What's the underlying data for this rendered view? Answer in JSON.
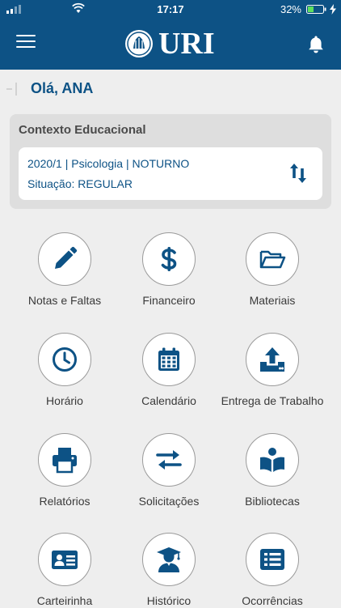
{
  "status_bar": {
    "time": "17:17",
    "battery": "32%"
  },
  "header": {
    "logo_text": "URI"
  },
  "greeting": "Olá, ANA",
  "context": {
    "title": "Contexto Educacional",
    "line1": "2020/1 | Psicologia | NOTURNO",
    "line2": "Situação: REGULAR"
  },
  "menu": [
    {
      "label": "Notas e Faltas",
      "icon": "pencil-icon"
    },
    {
      "label": "Financeiro",
      "icon": "dollar-icon"
    },
    {
      "label": "Materiais",
      "icon": "folder-open-icon"
    },
    {
      "label": "Horário",
      "icon": "clock-icon"
    },
    {
      "label": "Calendário",
      "icon": "calendar-icon"
    },
    {
      "label": "Entrega de Trabalho",
      "icon": "upload-icon"
    },
    {
      "label": "Relatórios",
      "icon": "printer-icon"
    },
    {
      "label": "Solicitações",
      "icon": "exchange-icon"
    },
    {
      "label": "Bibliotecas",
      "icon": "reader-icon"
    },
    {
      "label": "Carteirinha",
      "icon": "id-card-icon"
    },
    {
      "label": "Histórico",
      "icon": "graduate-icon"
    },
    {
      "label": "Ocorrências",
      "icon": "list-icon"
    }
  ],
  "colors": {
    "primary": "#0d5285",
    "background": "#eeeeee",
    "card": "#dedede"
  }
}
